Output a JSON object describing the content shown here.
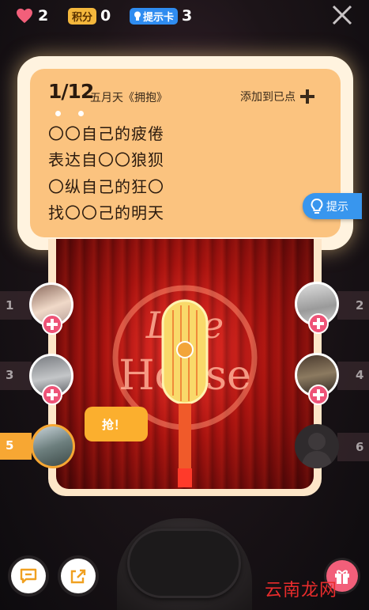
{
  "topbar": {
    "hearts": "2",
    "points_label": "积分",
    "points_value": "0",
    "hint_card_label": "提示卡",
    "hint_card_value": "3"
  },
  "question": {
    "number": "1/12",
    "song": "五月天《拥抱》",
    "add_label": "添加到已点",
    "lyrics": [
      "〇〇自己的疲倦",
      "表达自〇〇狼狈",
      "〇纵自己的狂〇",
      "找〇〇己的明天"
    ]
  },
  "hint_button": "提示",
  "stage_sign": {
    "line1": "Live",
    "line2": "House"
  },
  "seats": [
    {
      "number": "1",
      "side": "left"
    },
    {
      "number": "2",
      "side": "right"
    },
    {
      "number": "3",
      "side": "left"
    },
    {
      "number": "4",
      "side": "right"
    },
    {
      "number": "5",
      "side": "left"
    },
    {
      "number": "6",
      "side": "right"
    }
  ],
  "grab_bubble": "抢！",
  "watermark": "云南龙网",
  "colors": {
    "accent": "#fbc37f",
    "plus": "#ee5377",
    "hint": "#3896ee",
    "grab": "#fbaf2e"
  }
}
